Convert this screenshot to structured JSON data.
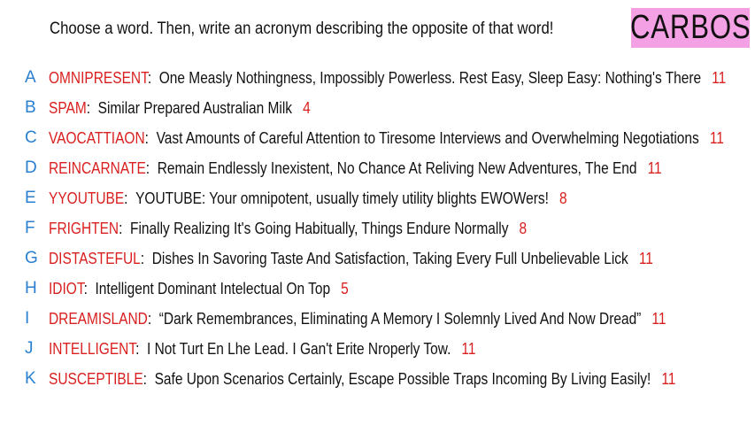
{
  "prompt": "Choose a word. Then, write an acronym describing the opposite of that word!",
  "badge": {
    "label": "CARBOS",
    "color": "#f4a0e4"
  },
  "colors": {
    "letter": "#2a7fd0",
    "word": "#d91f1f",
    "score": "#d91f1f",
    "text": "#111111"
  },
  "entries": [
    {
      "letter": "A",
      "word": "OMNIPRESENT",
      "acronym": "One Measly Nothingness, Impossibly Powerless. Rest Easy, Sleep Easy: Nothing's There",
      "score": "11"
    },
    {
      "letter": "B",
      "word": "SPAM",
      "acronym": "Similar Prepared Australian Milk",
      "score": "4"
    },
    {
      "letter": "C",
      "word": "VAOCATTIAON",
      "acronym": "Vast Amounts of Careful Attention to Tiresome Interviews and Overwhelming Negotiations",
      "score": "11"
    },
    {
      "letter": "D",
      "word": "REINCARNATE",
      "acronym": "Remain Endlessly Inexistent, No Chance At Reliving New Adventures, The End",
      "score": "11"
    },
    {
      "letter": "E",
      "word": "YYOUTUBE",
      "acronym": "YOUTUBE: Your omnipotent, usually timely utility blights EWOWers!",
      "score": "8"
    },
    {
      "letter": "F",
      "word": "FRIGHTEN",
      "acronym": "Finally Realizing It's Going Habitually, Things Endure Normally",
      "score": "8"
    },
    {
      "letter": "G",
      "word": "DISTASTEFUL",
      "acronym": "Dishes In Savoring Taste And Satisfaction, Taking Every Full Unbelievable Lick",
      "score": "11"
    },
    {
      "letter": "H",
      "word": "IDIOT",
      "acronym": "Intelligent Dominant Intelectual On Top",
      "score": "5"
    },
    {
      "letter": "I",
      "word": "DREAMISLAND",
      "acronym": "“Dark Remembrances, Eliminating A Memory I Solemnly Lived And Now Dread”",
      "score": "11"
    },
    {
      "letter": "J",
      "word": "INTELLIGENT",
      "acronym": "I Not Turt En Lhe Lead. I Gan't Erite Nroperly Tow.",
      "score": "11"
    },
    {
      "letter": "K",
      "word": "SUSCEPTIBLE",
      "acronym": "Safe Upon Scenarios Certainly, Escape Possible Traps Incoming By Living Easily!",
      "score": "11"
    }
  ]
}
